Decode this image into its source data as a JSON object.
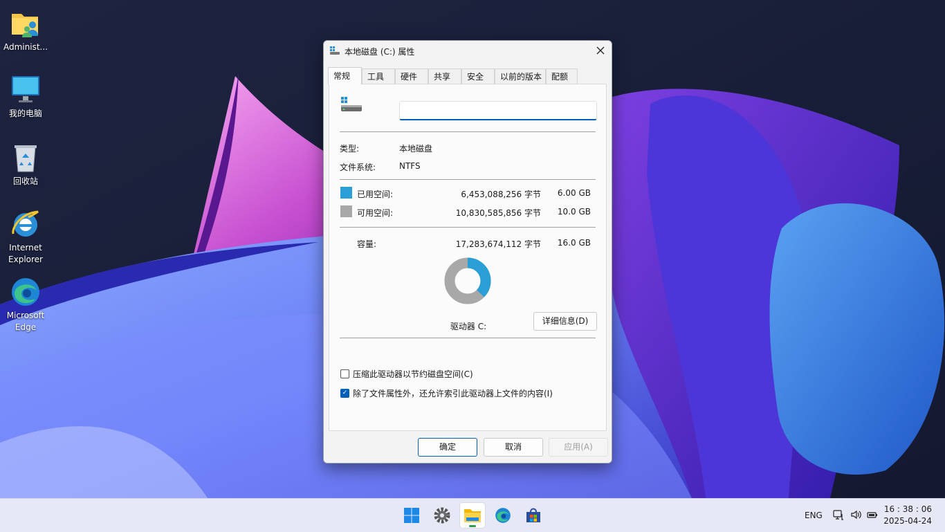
{
  "desktop": {
    "icons": [
      {
        "label": "Administ..."
      },
      {
        "label": "我的电脑"
      },
      {
        "label": "回收站"
      },
      {
        "label": "Internet Explorer"
      },
      {
        "label": "Microsoft Edge"
      }
    ]
  },
  "dialog": {
    "title": "本地磁盘 (C:) 属性",
    "close_icon": "close-icon",
    "tabs": [
      {
        "label": "常规",
        "active": true
      },
      {
        "label": "工具"
      },
      {
        "label": "硬件"
      },
      {
        "label": "共享"
      },
      {
        "label": "安全"
      },
      {
        "label": "以前的版本"
      },
      {
        "label": "配额"
      }
    ],
    "general": {
      "name_value": "",
      "type_label": "类型:",
      "type_value": "本地磁盘",
      "fs_label": "文件系统:",
      "fs_value": "NTFS",
      "used_label": "已用空间:",
      "used_bytes": "6,453,088,256 字节",
      "used_gb": "6.00 GB",
      "used_color": "#2a9fd6",
      "free_label": "可用空间:",
      "free_bytes": "10,830,585,856 字节",
      "free_gb": "10.0 GB",
      "free_color": "#a8a8a8",
      "capacity_label": "容量:",
      "capacity_bytes": "17,283,674,112 字节",
      "capacity_gb": "16.0 GB",
      "used_fraction": 0.3734,
      "drive_label": "驱动器 C:",
      "details_button": "详细信息(D)",
      "compress_label": "压缩此驱动器以节约磁盘空间(C)",
      "compress_checked": false,
      "index_label": "除了文件属性外，还允许索引此驱动器上文件的内容(I)",
      "index_checked": true
    },
    "buttons": {
      "ok": "确定",
      "cancel": "取消",
      "apply": "应用(A)"
    }
  },
  "taskbar": {
    "apps": [
      {
        "name": "start-icon"
      },
      {
        "name": "settings-icon"
      },
      {
        "name": "file-explorer-icon",
        "active": true
      },
      {
        "name": "edge-icon"
      },
      {
        "name": "store-icon"
      }
    ],
    "language": "ENG",
    "tray_icons": [
      "network-icon",
      "volume-icon",
      "battery-icon"
    ],
    "time": "16 : 38 : 06",
    "date": "2025-04-24"
  }
}
